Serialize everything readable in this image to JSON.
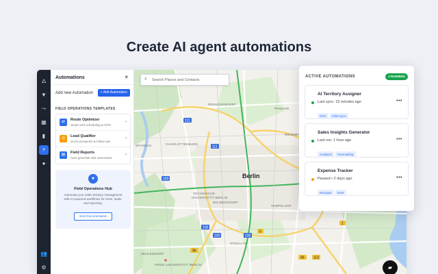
{
  "headline": "Create AI agent automations",
  "colors": {
    "accent": "#2563eb",
    "rail": "#1d2430",
    "running": "#16a34a",
    "active_dot": "#16a34a",
    "paused_dot": "#f59e0b"
  },
  "rail": {
    "icons": [
      "flame-icon",
      "filter-icon",
      "route-icon",
      "calendar-icon",
      "chart-icon",
      "lightning-icon",
      "bulb-icon",
      "users-icon",
      "gear-icon"
    ]
  },
  "panel": {
    "title": "Automations",
    "close": "×",
    "new_label": "Add new Automation",
    "add_button": "+ Add Automation",
    "section_title": "FIELD OPERATIONS TEMPLATES",
    "templates": [
      {
        "name": "Route Optimizer",
        "desc": "Smart visit scheduling & GPS",
        "icon": "route-icon",
        "color": "#2f6fea",
        "glyph": "⇄"
      },
      {
        "name": "Lead Qualifier",
        "desc": "Score prospects & follow-ups",
        "icon": "target-icon",
        "color": "#f59e0b",
        "glyph": "◎"
      },
      {
        "name": "Field Reports",
        "desc": "Auto-generate visit summaries",
        "icon": "report-icon",
        "color": "#2f6fea",
        "glyph": "▤"
      }
    ],
    "hub": {
      "title": "Field Operations Hub",
      "text": "Automate your sales territory management with AI-powered workflows for visits, leads, and reporting.",
      "button": "View Documentation"
    }
  },
  "map": {
    "search_placeholder": "Search Places and Contacts",
    "city_label": "Berlin",
    "labels": [
      "REINICKENDORF",
      "PANKOW",
      "WEISSENSEE",
      "SPANDAU",
      "CHARLOTTENBURG",
      "TECHNISCHE UNIVERSITÄT BERLIN",
      "WILMERSDORF",
      "TEMPELHOF",
      "LICHTENBERG",
      "MARZAHN",
      "ZEHLENDORF",
      "STEGLITZ",
      "FREIE UNIVERSITÄT BERLIN"
    ],
    "road_numbers": [
      "111",
      "111",
      "100",
      "100",
      "100",
      "100",
      "5",
      "96",
      "96",
      "1",
      "1",
      "113"
    ]
  },
  "automations": {
    "title": "ACTIVE AUTOMATIONS",
    "running_badge": "3 RUNNING",
    "items": [
      {
        "name": "AI Territory Assigner",
        "status": "Last sync: 15 minutes ago",
        "state": "active",
        "tags": [
          "GPS",
          "CRM Sync"
        ]
      },
      {
        "name": "Sales Insights Generator",
        "status": "Last run: 1 hour ago",
        "state": "active",
        "tags": [
          "Analytics",
          "Forecasting"
        ]
      },
      {
        "name": "Expense Tracker",
        "status": "Paused • 2 days ago",
        "state": "paused",
        "tags": [
          "Receipts",
          "OCR"
        ]
      }
    ],
    "more": "•••"
  }
}
